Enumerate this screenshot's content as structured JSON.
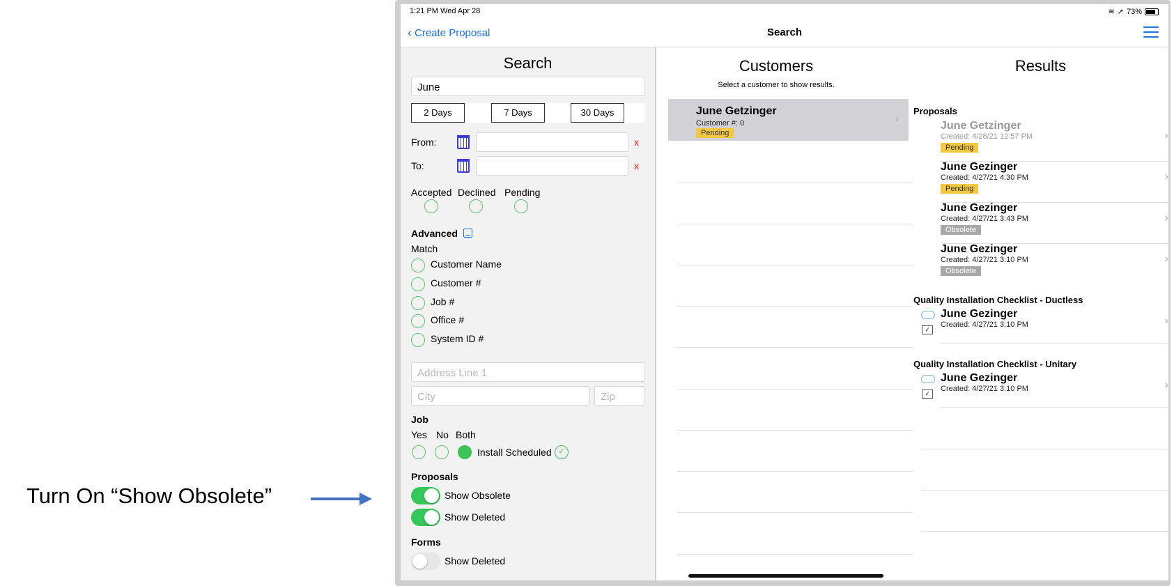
{
  "annotation": {
    "text": "Turn On “Show Obsolete”"
  },
  "status": {
    "time": "1:21 PM   Wed Apr 28",
    "battery": "73%",
    "battery_level": 0.73
  },
  "nav": {
    "back_label": "Create Proposal",
    "title": "Search"
  },
  "left": {
    "title": "Search",
    "search_value": "June",
    "day_buttons": [
      "2 Days",
      "7 Days",
      "30 Days"
    ],
    "from_label": "From:",
    "to_label": "To:",
    "clear_glyph": "x",
    "status_labels": [
      "Accepted",
      "Declined",
      "Pending"
    ],
    "advanced_label": "Advanced",
    "match_label": "Match",
    "match_options": [
      "Customer Name",
      "Customer #",
      "Job #",
      "Office #",
      "System ID #"
    ],
    "address_placeholder": "Address Line 1",
    "city_placeholder": "City",
    "zip_placeholder": "Zip",
    "job_label": "Job",
    "job_options": [
      "Yes",
      "No",
      "Both"
    ],
    "job_selected": "Both",
    "install_label": "Install Scheduled",
    "proposals_label": "Proposals",
    "show_obsolete_label": "Show Obsolete",
    "show_obsolete_on": true,
    "show_deleted_label": "Show Deleted",
    "show_deleted_on": true,
    "forms_label": "Forms",
    "forms_show_deleted_label": "Show Deleted",
    "forms_show_deleted_on": false
  },
  "customers": {
    "title": "Customers",
    "hint": "Select a customer to show results.",
    "items": [
      {
        "name": "June Getzinger",
        "number": "Customer #: 0",
        "status": "Pending"
      }
    ]
  },
  "results": {
    "title": "Results",
    "proposals_section": "Proposals",
    "proposals": [
      {
        "name": "June Getzinger",
        "created": "Created: 4/28/21 12:57 PM",
        "status": "Pending"
      },
      {
        "name": "June Gezinger",
        "created": "Created: 4/27/21 4:30 PM",
        "status": "Pending"
      },
      {
        "name": "June Gezinger",
        "created": "Created: 4/27/21 3:43 PM",
        "status": "Obsolete"
      },
      {
        "name": "June Gezinger",
        "created": "Created: 4/27/21 3:10 PM",
        "status": "Obsolete"
      }
    ],
    "ductless_section": "Quality Installation Checklist - Ductless",
    "ductless": {
      "name": "June Gezinger",
      "created": "Created: 4/27/21 3:10 PM"
    },
    "unitary_section": "Quality Installation Checklist - Unitary",
    "unitary": {
      "name": "June Gezinger",
      "created": "Created: 4/27/21 3:10 PM"
    }
  },
  "colors": {
    "accent": "#1a73e8",
    "toggle_on": "#34c759",
    "pending": "#f5c842",
    "obsolete": "#a8a8a8"
  }
}
